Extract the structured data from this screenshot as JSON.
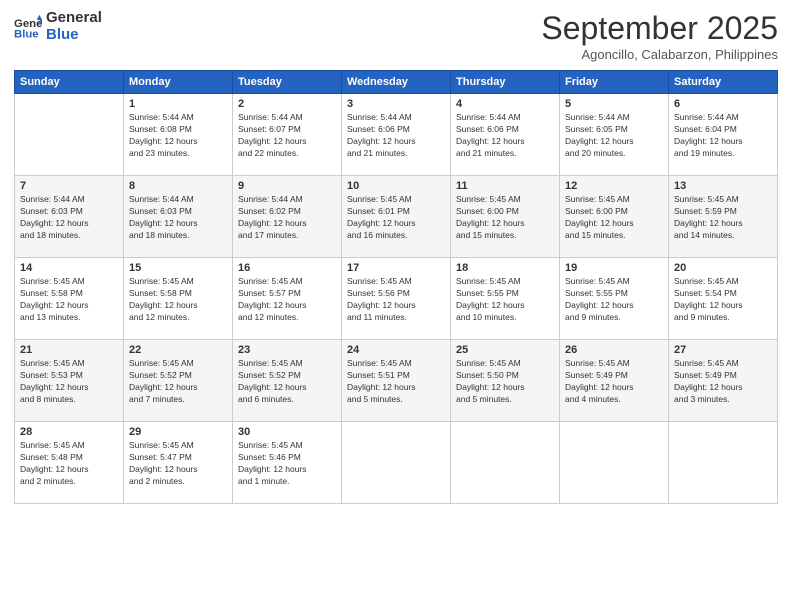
{
  "logo": {
    "line1": "General",
    "line2": "Blue"
  },
  "title": "September 2025",
  "location": "Agoncillo, Calabarzon, Philippines",
  "weekdays": [
    "Sunday",
    "Monday",
    "Tuesday",
    "Wednesday",
    "Thursday",
    "Friday",
    "Saturday"
  ],
  "weeks": [
    [
      {
        "day": "",
        "info": ""
      },
      {
        "day": "1",
        "info": "Sunrise: 5:44 AM\nSunset: 6:08 PM\nDaylight: 12 hours\nand 23 minutes."
      },
      {
        "day": "2",
        "info": "Sunrise: 5:44 AM\nSunset: 6:07 PM\nDaylight: 12 hours\nand 22 minutes."
      },
      {
        "day": "3",
        "info": "Sunrise: 5:44 AM\nSunset: 6:06 PM\nDaylight: 12 hours\nand 21 minutes."
      },
      {
        "day": "4",
        "info": "Sunrise: 5:44 AM\nSunset: 6:06 PM\nDaylight: 12 hours\nand 21 minutes."
      },
      {
        "day": "5",
        "info": "Sunrise: 5:44 AM\nSunset: 6:05 PM\nDaylight: 12 hours\nand 20 minutes."
      },
      {
        "day": "6",
        "info": "Sunrise: 5:44 AM\nSunset: 6:04 PM\nDaylight: 12 hours\nand 19 minutes."
      }
    ],
    [
      {
        "day": "7",
        "info": "Sunrise: 5:44 AM\nSunset: 6:03 PM\nDaylight: 12 hours\nand 18 minutes."
      },
      {
        "day": "8",
        "info": "Sunrise: 5:44 AM\nSunset: 6:03 PM\nDaylight: 12 hours\nand 18 minutes."
      },
      {
        "day": "9",
        "info": "Sunrise: 5:44 AM\nSunset: 6:02 PM\nDaylight: 12 hours\nand 17 minutes."
      },
      {
        "day": "10",
        "info": "Sunrise: 5:45 AM\nSunset: 6:01 PM\nDaylight: 12 hours\nand 16 minutes."
      },
      {
        "day": "11",
        "info": "Sunrise: 5:45 AM\nSunset: 6:00 PM\nDaylight: 12 hours\nand 15 minutes."
      },
      {
        "day": "12",
        "info": "Sunrise: 5:45 AM\nSunset: 6:00 PM\nDaylight: 12 hours\nand 15 minutes."
      },
      {
        "day": "13",
        "info": "Sunrise: 5:45 AM\nSunset: 5:59 PM\nDaylight: 12 hours\nand 14 minutes."
      }
    ],
    [
      {
        "day": "14",
        "info": "Sunrise: 5:45 AM\nSunset: 5:58 PM\nDaylight: 12 hours\nand 13 minutes."
      },
      {
        "day": "15",
        "info": "Sunrise: 5:45 AM\nSunset: 5:58 PM\nDaylight: 12 hours\nand 12 minutes."
      },
      {
        "day": "16",
        "info": "Sunrise: 5:45 AM\nSunset: 5:57 PM\nDaylight: 12 hours\nand 12 minutes."
      },
      {
        "day": "17",
        "info": "Sunrise: 5:45 AM\nSunset: 5:56 PM\nDaylight: 12 hours\nand 11 minutes."
      },
      {
        "day": "18",
        "info": "Sunrise: 5:45 AM\nSunset: 5:55 PM\nDaylight: 12 hours\nand 10 minutes."
      },
      {
        "day": "19",
        "info": "Sunrise: 5:45 AM\nSunset: 5:55 PM\nDaylight: 12 hours\nand 9 minutes."
      },
      {
        "day": "20",
        "info": "Sunrise: 5:45 AM\nSunset: 5:54 PM\nDaylight: 12 hours\nand 9 minutes."
      }
    ],
    [
      {
        "day": "21",
        "info": "Sunrise: 5:45 AM\nSunset: 5:53 PM\nDaylight: 12 hours\nand 8 minutes."
      },
      {
        "day": "22",
        "info": "Sunrise: 5:45 AM\nSunset: 5:52 PM\nDaylight: 12 hours\nand 7 minutes."
      },
      {
        "day": "23",
        "info": "Sunrise: 5:45 AM\nSunset: 5:52 PM\nDaylight: 12 hours\nand 6 minutes."
      },
      {
        "day": "24",
        "info": "Sunrise: 5:45 AM\nSunset: 5:51 PM\nDaylight: 12 hours\nand 5 minutes."
      },
      {
        "day": "25",
        "info": "Sunrise: 5:45 AM\nSunset: 5:50 PM\nDaylight: 12 hours\nand 5 minutes."
      },
      {
        "day": "26",
        "info": "Sunrise: 5:45 AM\nSunset: 5:49 PM\nDaylight: 12 hours\nand 4 minutes."
      },
      {
        "day": "27",
        "info": "Sunrise: 5:45 AM\nSunset: 5:49 PM\nDaylight: 12 hours\nand 3 minutes."
      }
    ],
    [
      {
        "day": "28",
        "info": "Sunrise: 5:45 AM\nSunset: 5:48 PM\nDaylight: 12 hours\nand 2 minutes."
      },
      {
        "day": "29",
        "info": "Sunrise: 5:45 AM\nSunset: 5:47 PM\nDaylight: 12 hours\nand 2 minutes."
      },
      {
        "day": "30",
        "info": "Sunrise: 5:45 AM\nSunset: 5:46 PM\nDaylight: 12 hours\nand 1 minute."
      },
      {
        "day": "",
        "info": ""
      },
      {
        "day": "",
        "info": ""
      },
      {
        "day": "",
        "info": ""
      },
      {
        "day": "",
        "info": ""
      }
    ]
  ]
}
